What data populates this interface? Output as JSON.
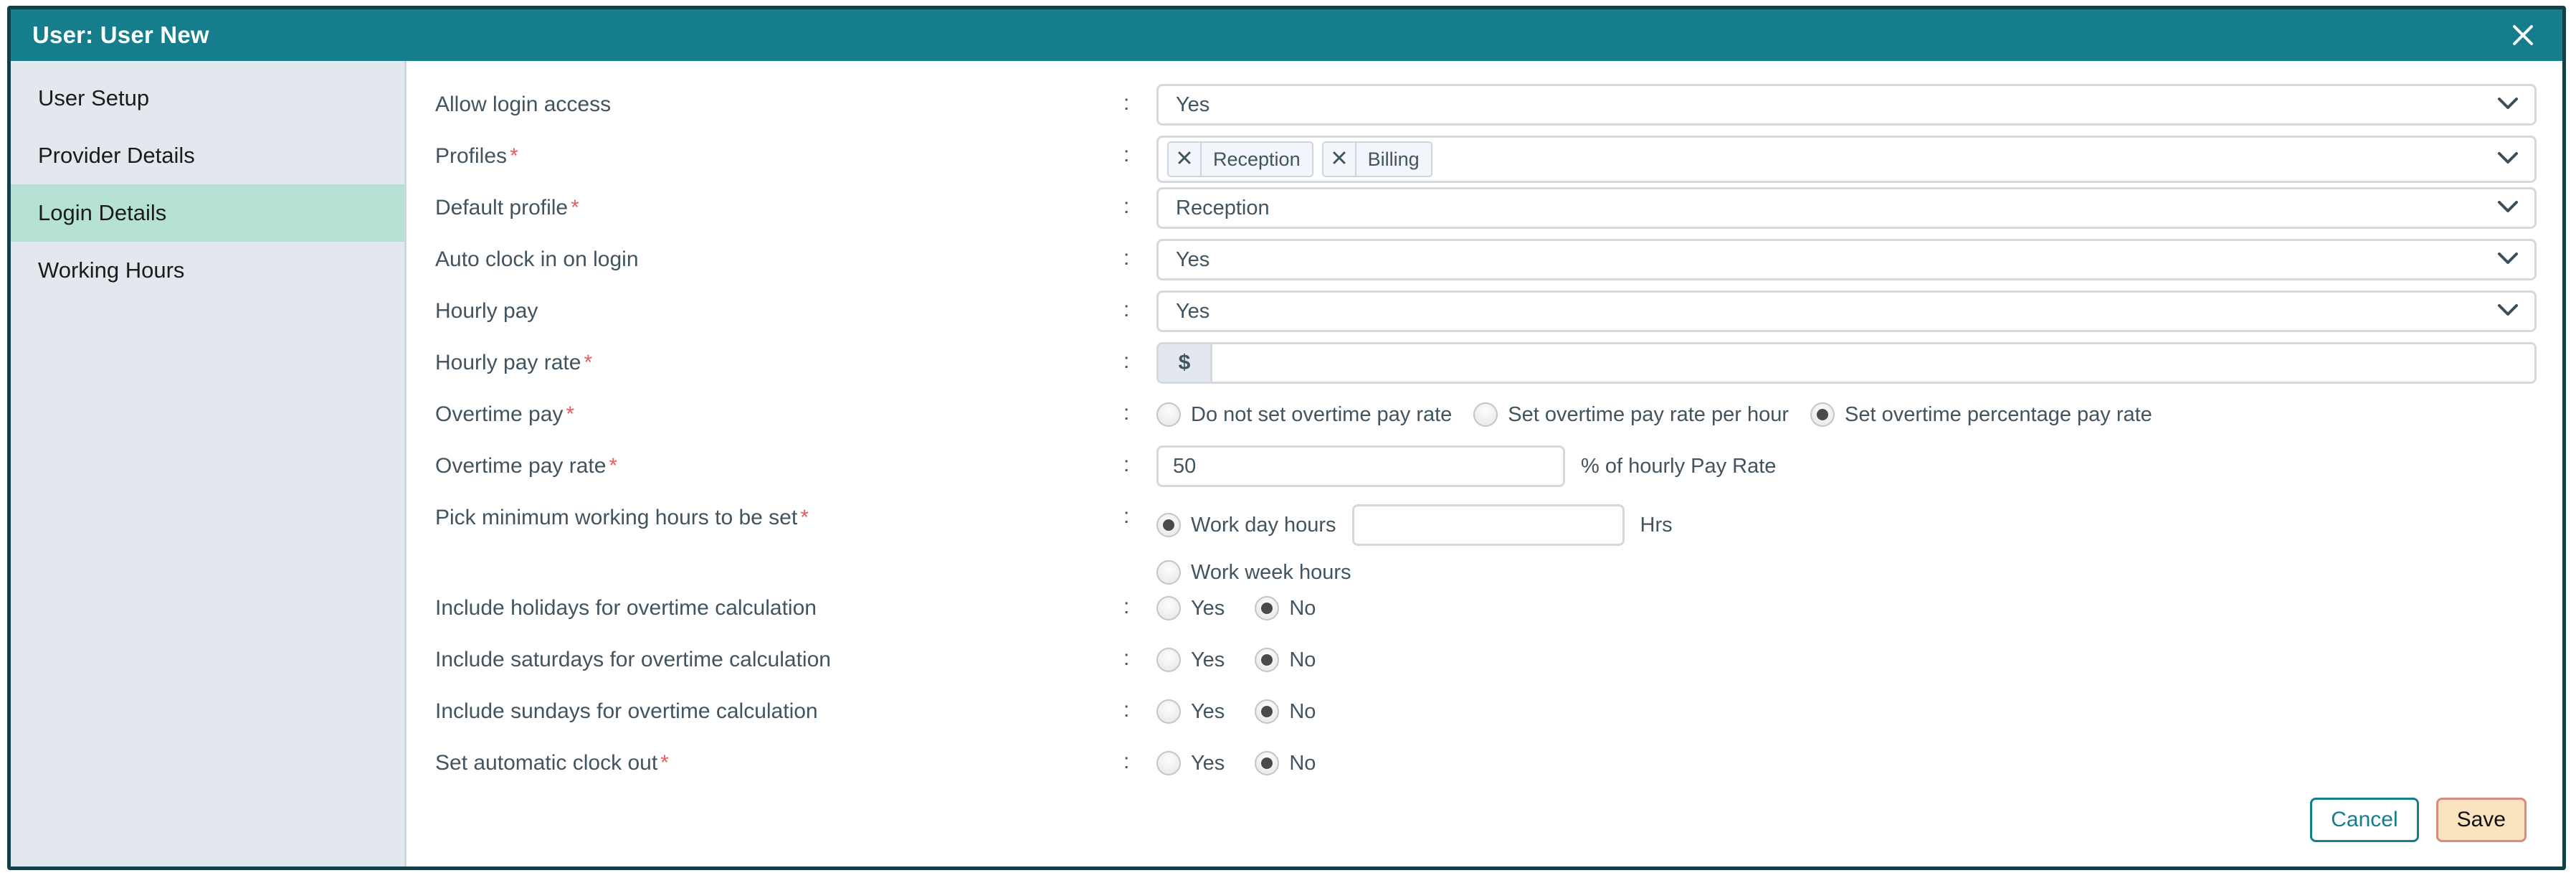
{
  "titlebar": {
    "title": "User: User New",
    "close_icon": "close-icon"
  },
  "sidebar": {
    "items": [
      {
        "label": "User Setup",
        "active": false
      },
      {
        "label": "Provider Details",
        "active": false
      },
      {
        "label": "Login Details",
        "active": true
      },
      {
        "label": "Working Hours",
        "active": false
      }
    ]
  },
  "separator": ":",
  "form": {
    "allow_login_access": {
      "label": "Allow login access",
      "required": false,
      "value": "Yes",
      "icon": "chevron-down-icon"
    },
    "profiles": {
      "label": "Profiles",
      "required": true,
      "chips": [
        {
          "label": "Reception",
          "remove_icon": "close-icon"
        },
        {
          "label": "Billing",
          "remove_icon": "close-icon"
        }
      ],
      "icon": "chevron-down-icon"
    },
    "default_profile": {
      "label": "Default profile",
      "required": true,
      "value": "Reception",
      "icon": "chevron-down-icon"
    },
    "auto_clock_in": {
      "label": "Auto clock in on login",
      "required": false,
      "value": "Yes",
      "icon": "chevron-down-icon"
    },
    "hourly_pay": {
      "label": "Hourly pay",
      "required": false,
      "value": "Yes",
      "icon": "chevron-down-icon"
    },
    "hourly_pay_rate": {
      "label": "Hourly pay rate",
      "required": true,
      "prefix": "$",
      "value": "",
      "placeholder": ""
    },
    "overtime_pay": {
      "label": "Overtime pay",
      "required": true,
      "options": [
        {
          "label": "Do not set overtime pay rate",
          "selected": false
        },
        {
          "label": "Set overtime pay rate per hour",
          "selected": false
        },
        {
          "label": "Set overtime percentage pay rate",
          "selected": true
        }
      ]
    },
    "overtime_pay_rate": {
      "label": "Overtime pay rate",
      "required": true,
      "value": "50",
      "suffix": "% of hourly Pay Rate"
    },
    "min_working_hours": {
      "label": "Pick minimum working hours to be set",
      "required": true,
      "options": [
        {
          "label": "Work day hours",
          "selected": true
        },
        {
          "label": "Work week hours",
          "selected": false
        }
      ],
      "hours_value": "",
      "hours_suffix": "Hrs"
    },
    "include_holidays": {
      "label": "Include holidays for overtime calculation",
      "required": false,
      "options": [
        {
          "label": "Yes",
          "selected": false
        },
        {
          "label": "No",
          "selected": true
        }
      ]
    },
    "include_saturdays": {
      "label": "Include saturdays for overtime calculation",
      "required": false,
      "options": [
        {
          "label": "Yes",
          "selected": false
        },
        {
          "label": "No",
          "selected": true
        }
      ]
    },
    "include_sundays": {
      "label": "Include sundays for overtime calculation",
      "required": false,
      "options": [
        {
          "label": "Yes",
          "selected": false
        },
        {
          "label": "No",
          "selected": true
        }
      ]
    },
    "auto_clock_out": {
      "label": "Set automatic clock out",
      "required": true,
      "options": [
        {
          "label": "Yes",
          "selected": false
        },
        {
          "label": "No",
          "selected": true
        }
      ]
    }
  },
  "footer": {
    "cancel_label": "Cancel",
    "save_label": "Save"
  },
  "colors": {
    "header_teal": "#157d8c",
    "modal_border": "#133f47",
    "sidebar_bg": "#e2e8ee",
    "sidebar_active": "#b5e2d4",
    "label_text": "#41545f",
    "required_red": "#ef5b5b",
    "save_bg": "#fae3bf",
    "save_border": "#d98a82"
  }
}
